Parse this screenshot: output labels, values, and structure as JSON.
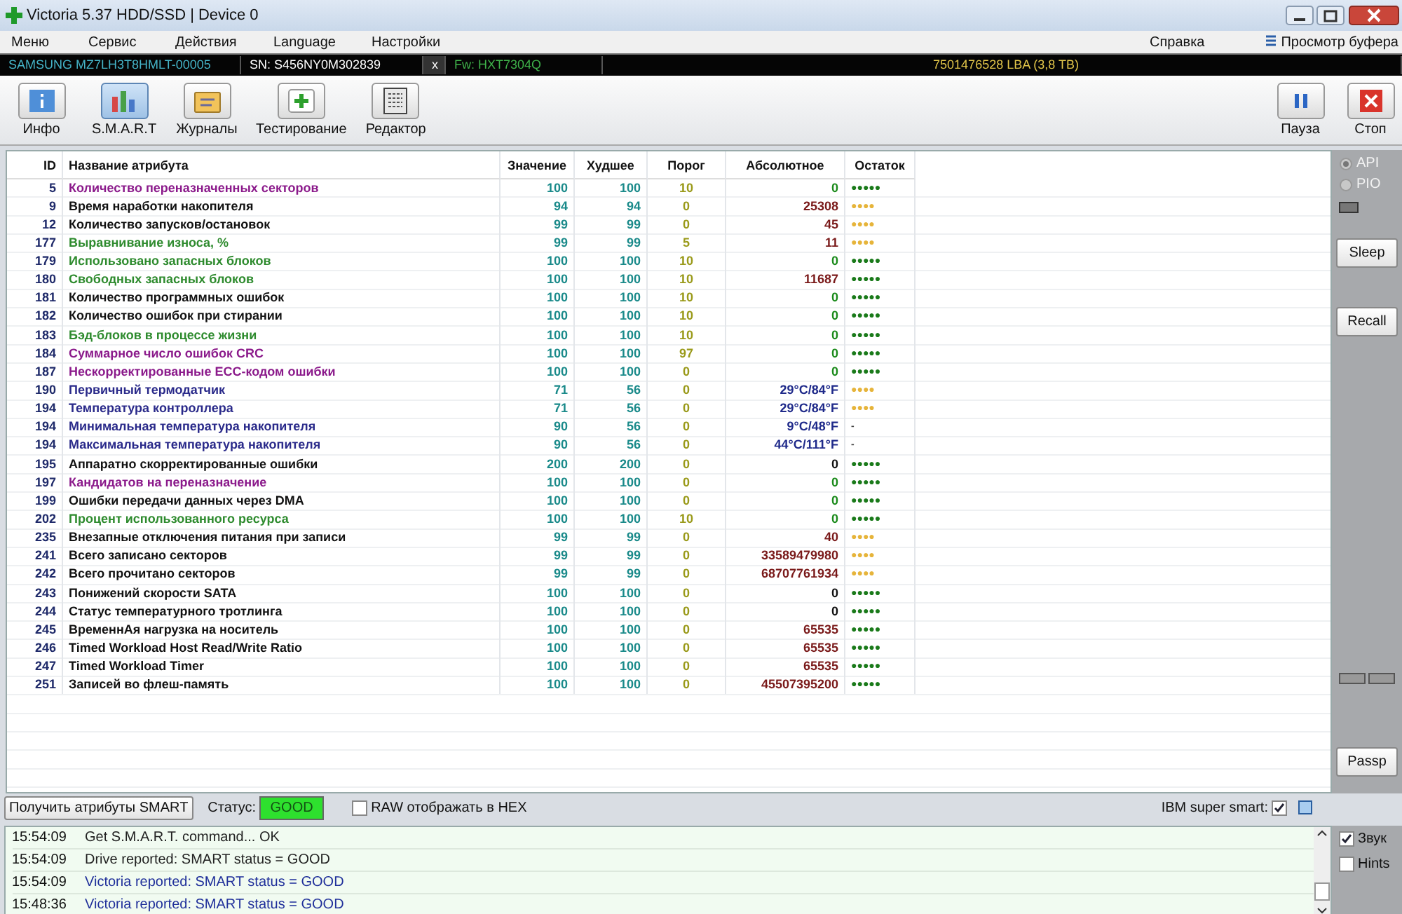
{
  "window": {
    "title": "Victoria 5.37 HDD/SSD | Device 0"
  },
  "menu": [
    {
      "label": "Меню"
    },
    {
      "label": "Сервис"
    },
    {
      "label": "Действия"
    },
    {
      "label": "Language"
    },
    {
      "label": "Настройки"
    }
  ],
  "menu_right": [
    {
      "label": "Справка"
    },
    {
      "label": "Просмотр буфера"
    }
  ],
  "drive": {
    "model": "SAMSUNG MZ7LH3T8HMLT-00005",
    "serial": "SN: S456NY0M302839",
    "close": "x",
    "firmware": "Fw: HXT7304Q",
    "capacity": "7501476528 LBA (3,8 TB)"
  },
  "toolbar": [
    {
      "label": "Инфо",
      "kind": "info",
      "selected": false
    },
    {
      "label": "S.M.A.R.T",
      "kind": "smart",
      "selected": true
    },
    {
      "label": "Журналы",
      "kind": "logs",
      "selected": false
    },
    {
      "label": "Тестирование",
      "kind": "test",
      "selected": false
    },
    {
      "label": "Редактор",
      "kind": "editor",
      "selected": false
    }
  ],
  "toolbar_right": [
    {
      "label": "Пауза",
      "kind": "pause"
    },
    {
      "label": "Стоп",
      "kind": "stop"
    }
  ],
  "table": {
    "columns": [
      "ID",
      "Название атрибута",
      "Значение",
      "Худшее",
      "Порог",
      "Абсолютное",
      "Остаток"
    ],
    "rows": [
      {
        "id": "5",
        "name": "Количество переназначенных секторов",
        "color": "#8b1a8b",
        "value": "100",
        "worst": "100",
        "threshold": "10",
        "raw": {
          "text": "0",
          "color": "#1a8a1a"
        },
        "remaining": {
          "text": "●●●●●",
          "color": "#1a7a1a"
        }
      },
      {
        "id": "9",
        "name": "Время наработки накопителя",
        "color": "#111111",
        "value": "94",
        "worst": "94",
        "threshold": "0",
        "raw": {
          "text": "25308",
          "color": "#7a1a1a"
        },
        "remaining": {
          "text": "●●●●",
          "color": "#e6b43a"
        }
      },
      {
        "id": "12",
        "name": "Количество запусков/остановок",
        "color": "#111111",
        "value": "99",
        "worst": "99",
        "threshold": "0",
        "raw": {
          "text": "45",
          "color": "#7a1a1a"
        },
        "remaining": {
          "text": "●●●●",
          "color": "#e6b43a"
        }
      },
      {
        "id": "177",
        "name": "Выравнивание износа, %",
        "color": "#2e8b2e",
        "value": "99",
        "worst": "99",
        "threshold": "5",
        "raw": {
          "text": "11",
          "color": "#7a1a1a"
        },
        "remaining": {
          "text": "●●●●",
          "color": "#e6b43a"
        }
      },
      {
        "id": "179",
        "name": "Использовано запасных блоков",
        "color": "#2e8b2e",
        "value": "100",
        "worst": "100",
        "threshold": "10",
        "raw": {
          "text": "0",
          "color": "#1a8a1a"
        },
        "remaining": {
          "text": "●●●●●",
          "color": "#1a7a1a"
        }
      },
      {
        "id": "180",
        "name": "Свободных запасных блоков",
        "color": "#2e8b2e",
        "value": "100",
        "worst": "100",
        "threshold": "10",
        "raw": {
          "text": "11687",
          "color": "#7a1a1a"
        },
        "remaining": {
          "text": "●●●●●",
          "color": "#1a7a1a"
        }
      },
      {
        "id": "181",
        "name": "Количество программных ошибок",
        "color": "#111111",
        "value": "100",
        "worst": "100",
        "threshold": "10",
        "raw": {
          "text": "0",
          "color": "#1a8a1a"
        },
        "remaining": {
          "text": "●●●●●",
          "color": "#1a7a1a"
        }
      },
      {
        "id": "182",
        "name": "Количество ошибок при стирании",
        "color": "#111111",
        "value": "100",
        "worst": "100",
        "threshold": "10",
        "raw": {
          "text": "0",
          "color": "#1a8a1a"
        },
        "remaining": {
          "text": "●●●●●",
          "color": "#1a7a1a"
        }
      },
      {
        "id": "183",
        "name": "Бэд-блоков в процессе жизни",
        "color": "#2e8b2e",
        "value": "100",
        "worst": "100",
        "threshold": "10",
        "raw": {
          "text": "0",
          "color": "#1a8a1a"
        },
        "remaining": {
          "text": "●●●●●",
          "color": "#1a7a1a"
        }
      },
      {
        "id": "184",
        "name": "Суммарное число ошибок CRC",
        "color": "#8b1a8b",
        "value": "100",
        "worst": "100",
        "threshold": "97",
        "raw": {
          "text": "0",
          "color": "#1a8a1a"
        },
        "remaining": {
          "text": "●●●●●",
          "color": "#1a7a1a"
        }
      },
      {
        "id": "187",
        "name": "Нескорректированные ECC-кодом ошибки",
        "color": "#8b1a8b",
        "value": "100",
        "worst": "100",
        "threshold": "0",
        "raw": {
          "text": "0",
          "color": "#1a8a1a"
        },
        "remaining": {
          "text": "●●●●●",
          "color": "#1a7a1a"
        }
      },
      {
        "id": "190",
        "name": "Первичный термодатчик",
        "color": "#2a2a8a",
        "value": "71",
        "worst": "56",
        "threshold": "0",
        "raw": {
          "text": "29°C/84°F",
          "color": "#1f2a8a"
        },
        "remaining": {
          "text": "●●●●",
          "color": "#e6b43a"
        }
      },
      {
        "id": "194",
        "name": "Температура контроллера",
        "color": "#2a2a8a",
        "value": "71",
        "worst": "56",
        "threshold": "0",
        "raw": {
          "text": "29°C/84°F",
          "color": "#1f2a8a"
        },
        "remaining": {
          "text": "●●●●",
          "color": "#e6b43a"
        }
      },
      {
        "id": "194",
        "name": "Минимальная температура накопителя",
        "color": "#2a2a8a",
        "value": "90",
        "worst": "56",
        "threshold": "0",
        "raw": {
          "text": "9°C/48°F",
          "color": "#1f2a8a"
        },
        "remaining": {
          "text": "-",
          "color": "#444444"
        }
      },
      {
        "id": "194",
        "name": "Максимальная температура накопителя",
        "color": "#2a2a8a",
        "value": "90",
        "worst": "56",
        "threshold": "0",
        "raw": {
          "text": "44°C/111°F",
          "color": "#1f2a8a"
        },
        "remaining": {
          "text": "-",
          "color": "#444444"
        }
      },
      {
        "id": "195",
        "name": "Аппаратно скорректированные ошибки",
        "color": "#111111",
        "value": "200",
        "worst": "200",
        "threshold": "0",
        "raw": {
          "text": "0",
          "color": "#111111"
        },
        "remaining": {
          "text": "●●●●●",
          "color": "#1a7a1a"
        }
      },
      {
        "id": "197",
        "name": "Кандидатов на переназначение",
        "color": "#8b1a8b",
        "value": "100",
        "worst": "100",
        "threshold": "0",
        "raw": {
          "text": "0",
          "color": "#1a8a1a"
        },
        "remaining": {
          "text": "●●●●●",
          "color": "#1a7a1a"
        }
      },
      {
        "id": "199",
        "name": "Ошибки передачи данных через DMA",
        "color": "#111111",
        "value": "100",
        "worst": "100",
        "threshold": "0",
        "raw": {
          "text": "0",
          "color": "#1a8a1a"
        },
        "remaining": {
          "text": "●●●●●",
          "color": "#1a7a1a"
        }
      },
      {
        "id": "202",
        "name": "Процент использованного ресурса",
        "color": "#2e8b2e",
        "value": "100",
        "worst": "100",
        "threshold": "10",
        "raw": {
          "text": "0",
          "color": "#1a8a1a"
        },
        "remaining": {
          "text": "●●●●●",
          "color": "#1a7a1a"
        }
      },
      {
        "id": "235",
        "name": "Внезапные отключения питания при записи",
        "color": "#111111",
        "value": "99",
        "worst": "99",
        "threshold": "0",
        "raw": {
          "text": "40",
          "color": "#7a1a1a"
        },
        "remaining": {
          "text": "●●●●",
          "color": "#e6b43a"
        }
      },
      {
        "id": "241",
        "name": "Всего записано секторов",
        "color": "#111111",
        "value": "99",
        "worst": "99",
        "threshold": "0",
        "raw": {
          "text": "33589479980",
          "color": "#7a1a1a"
        },
        "remaining": {
          "text": "●●●●",
          "color": "#e6b43a"
        }
      },
      {
        "id": "242",
        "name": "Всего прочитано секторов",
        "color": "#111111",
        "value": "99",
        "worst": "99",
        "threshold": "0",
        "raw": {
          "text": "68707761934",
          "color": "#7a1a1a"
        },
        "remaining": {
          "text": "●●●●",
          "color": "#e6b43a"
        }
      },
      {
        "id": "243",
        "name": "Понижений скорости SATA",
        "color": "#111111",
        "value": "100",
        "worst": "100",
        "threshold": "0",
        "raw": {
          "text": "0",
          "color": "#111111"
        },
        "remaining": {
          "text": "●●●●●",
          "color": "#1a7a1a"
        }
      },
      {
        "id": "244",
        "name": "Статус температурного тротлинга",
        "color": "#111111",
        "value": "100",
        "worst": "100",
        "threshold": "0",
        "raw": {
          "text": "0",
          "color": "#111111"
        },
        "remaining": {
          "text": "●●●●●",
          "color": "#1a7a1a"
        }
      },
      {
        "id": "245",
        "name": "ВременнАя нагрузка на носитель",
        "color": "#111111",
        "value": "100",
        "worst": "100",
        "threshold": "0",
        "raw": {
          "text": "65535",
          "color": "#7a1a1a"
        },
        "remaining": {
          "text": "●●●●●",
          "color": "#1a7a1a"
        }
      },
      {
        "id": "246",
        "name": "Timed Workload Host Read/Write Ratio",
        "color": "#111111",
        "value": "100",
        "worst": "100",
        "threshold": "0",
        "raw": {
          "text": "65535",
          "color": "#7a1a1a"
        },
        "remaining": {
          "text": "●●●●●",
          "color": "#1a7a1a"
        }
      },
      {
        "id": "247",
        "name": "Timed Workload Timer",
        "color": "#111111",
        "value": "100",
        "worst": "100",
        "threshold": "0",
        "raw": {
          "text": "65535",
          "color": "#7a1a1a"
        },
        "remaining": {
          "text": "●●●●●",
          "color": "#1a7a1a"
        }
      },
      {
        "id": "251",
        "name": "Записей во флеш-память",
        "color": "#111111",
        "value": "100",
        "worst": "100",
        "threshold": "0",
        "raw": {
          "text": "45507395200",
          "color": "#7a1a1a"
        },
        "remaining": {
          "text": "●●●●●",
          "color": "#1a7a1a"
        }
      }
    ]
  },
  "side_panel": {
    "radios": [
      {
        "label": "API",
        "selected": true,
        "disabled": true
      },
      {
        "label": "PIO",
        "selected": false,
        "disabled": true
      }
    ],
    "buttons": [
      {
        "label": "Sleep"
      },
      {
        "label": "Recall"
      },
      {
        "label": "Passp"
      }
    ]
  },
  "status_bar": {
    "get_button": "Получить атрибуты SMART",
    "status_label": "Статус:",
    "status": "GOOD",
    "hex": {
      "label": "RAW отображать в HEX",
      "checked": false
    },
    "ibm": {
      "label": "IBM super smart:",
      "checked": true
    }
  },
  "log": [
    {
      "time": "15:54:09",
      "text": "Get S.M.A.R.T. command... OK",
      "color": "#222222"
    },
    {
      "time": "15:54:09",
      "text": "Drive reported: SMART status = GOOD",
      "color": "#222222"
    },
    {
      "time": "15:54:09",
      "text": "Victoria reported: SMART status = GOOD",
      "color": "#1f2f9a"
    },
    {
      "time": "15:48:36",
      "text": "Victoria reported: SMART status = GOOD",
      "color": "#1f2f9a"
    }
  ],
  "log_options": [
    {
      "label": "Звук",
      "checked": true
    },
    {
      "label": "Hints",
      "checked": false
    }
  ]
}
